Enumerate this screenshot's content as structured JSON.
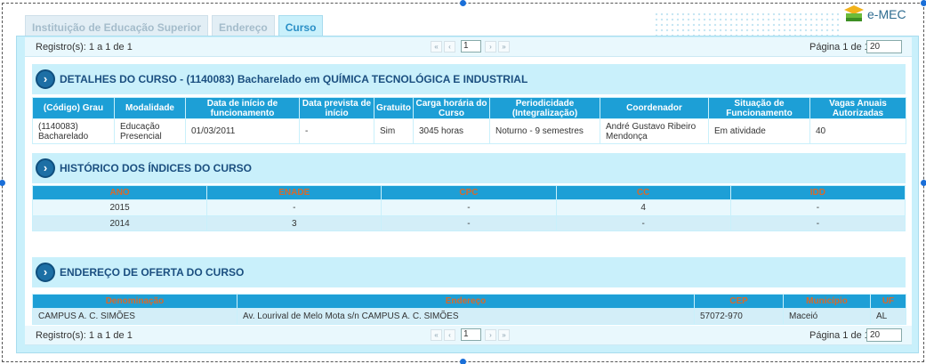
{
  "logo": {
    "text": "e-MEC",
    "icon": "mortarboard-book-icon"
  },
  "tabs": [
    {
      "label": "Instituição de Educação Superior"
    },
    {
      "label": "Endereço"
    },
    {
      "label": "Curso"
    }
  ],
  "pager_top": {
    "records": "Registro(s): 1 a 1 de 1",
    "page_label": "Página 1 de 1",
    "page_select": "1",
    "per_page": "20",
    "nav": {
      "first": "«",
      "prev": "‹",
      "next": "›",
      "last": "»"
    }
  },
  "detalhes": {
    "title": "DETALHES DO CURSO - (1140083) Bacharelado em QUÍMICA TECNOLÓGICA E INDUSTRIAL",
    "headers": [
      "(Código) Grau",
      "Modalidade",
      "Data de início de funcionamento",
      "Data prevista de início",
      "Gratuito",
      "Carga horária do Curso",
      "Periodicidade (Integralização)",
      "Coordenador",
      "Situação de Funcionamento",
      "Vagas Anuais Autorizadas"
    ],
    "row": [
      "(1140083) Bacharelado",
      "Educação Presencial",
      "01/03/2011",
      "-",
      "Sim",
      "3045 horas",
      "Noturno - 9 semestres",
      "André Gustavo Ribeiro Mendonça",
      "Em atividade",
      "40"
    ]
  },
  "historico": {
    "title": "HISTÓRICO DOS ÍNDICES DO CURSO",
    "headers": [
      "ANO",
      "ENADE",
      "CPC",
      "CC",
      "IDD"
    ],
    "rows": [
      [
        "2015",
        "-",
        "-",
        "4",
        "-"
      ],
      [
        "2014",
        "3",
        "-",
        "-",
        "-"
      ]
    ]
  },
  "oferta": {
    "title": "ENDEREÇO DE OFERTA DO CURSO",
    "headers": [
      "Denominação",
      "Endereço",
      "CEP",
      "Município",
      "UF"
    ],
    "row": [
      "CAMPUS A. C. SIMÕES",
      "Av. Lourival de Melo Mota s/n CAMPUS A. C. SIMÕES",
      "57072-970",
      "Maceió",
      "AL"
    ]
  },
  "pager_bottom": {
    "records": "Registro(s): 1 a 1 de 1",
    "page_label": "Página 1 de 1",
    "page_select": "1",
    "per_page": "20"
  },
  "section_icon": "circle-arrow-right-icon"
}
